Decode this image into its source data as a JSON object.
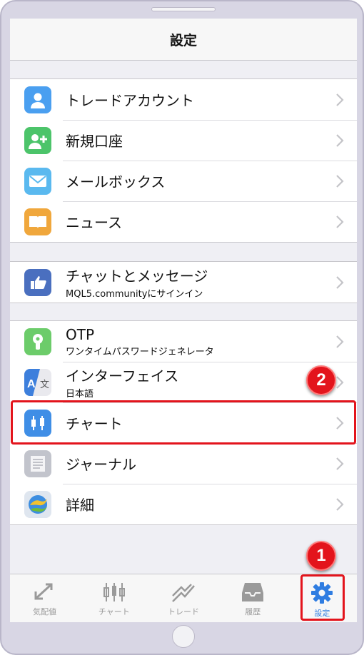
{
  "header": {
    "title": "設定"
  },
  "groups": [
    {
      "items": [
        {
          "label": "トレードアカウント"
        },
        {
          "label": "新規口座"
        },
        {
          "label": "メールボックス"
        },
        {
          "label": "ニュース"
        }
      ]
    },
    {
      "items": [
        {
          "label": "チャットとメッセージ",
          "sublabel": "MQL5.communityにサインイン"
        }
      ]
    },
    {
      "items": [
        {
          "label": "OTP",
          "sublabel": "ワンタイムパスワードジェネレータ"
        },
        {
          "label": "インターフェイス",
          "sublabel": "日本語"
        },
        {
          "label": "チャート"
        },
        {
          "label": "ジャーナル"
        },
        {
          "label": "詳細"
        }
      ]
    }
  ],
  "tabbar": {
    "tabs": [
      {
        "label": "気配値"
      },
      {
        "label": "チャート"
      },
      {
        "label": "トレード"
      },
      {
        "label": "履歴"
      },
      {
        "label": "設定"
      }
    ],
    "active": "設定"
  },
  "annotations": {
    "marker1": "1",
    "marker2": "2"
  },
  "colors": {
    "accent": "#2f7de1",
    "highlight": "#e3141c"
  }
}
